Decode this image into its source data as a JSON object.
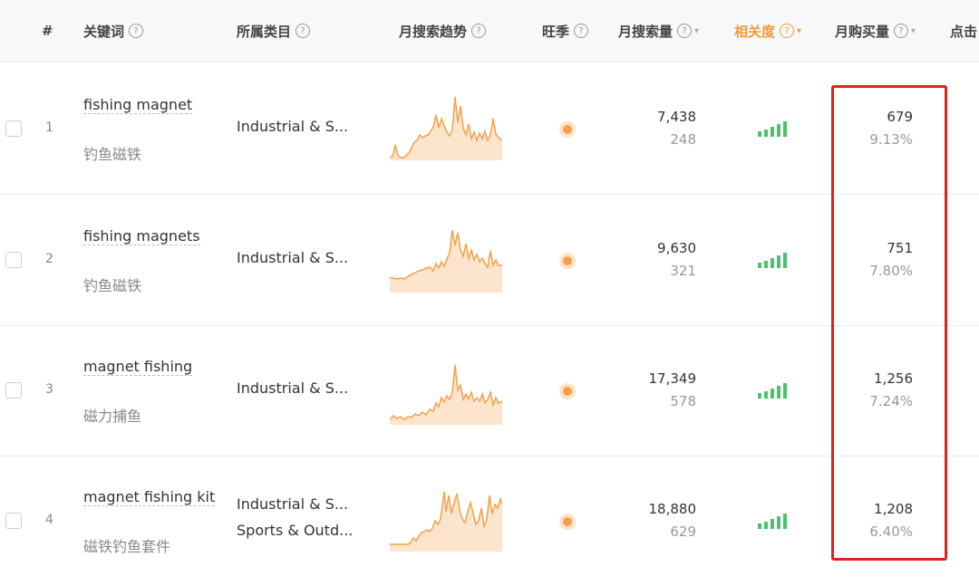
{
  "header": {
    "index": "#",
    "keyword": "关键词",
    "category": "所属类目",
    "trend": "月搜索趋势",
    "peak_season": "旺季",
    "monthly_search": "月搜索量",
    "relevance": "相关度",
    "monthly_purchase": "月购买量",
    "clicks": "点击"
  },
  "accent_color": "#f29a35",
  "highlight_color": "#e3211c",
  "rows": [
    {
      "index": "1",
      "keyword": "fishing magnet",
      "keyword_cn": "钓鱼磁铁",
      "categories": [
        "Industrial & S..."
      ],
      "search_volume": "7,438",
      "search_sub": "248",
      "relevance_level": 5,
      "purchase": "679",
      "purchase_rate": "9.13%"
    },
    {
      "index": "2",
      "keyword": "fishing magnets",
      "keyword_cn": "钓鱼磁铁",
      "categories": [
        "Industrial & S..."
      ],
      "search_volume": "9,630",
      "search_sub": "321",
      "relevance_level": 5,
      "purchase": "751",
      "purchase_rate": "7.80%"
    },
    {
      "index": "3",
      "keyword": "magnet fishing",
      "keyword_cn": "磁力捕鱼",
      "categories": [
        "Industrial & S..."
      ],
      "search_volume": "17,349",
      "search_sub": "578",
      "relevance_level": 5,
      "purchase": "1,256",
      "purchase_rate": "7.24%"
    },
    {
      "index": "4",
      "keyword": "magnet fishing kit",
      "keyword_cn": "磁铁钓鱼套件",
      "categories": [
        "Industrial & S...",
        "Sports & Outd..."
      ],
      "search_volume": "18,880",
      "search_sub": "629",
      "relevance_level": 5,
      "purchase": "1,208",
      "purchase_rate": "6.40%"
    }
  ]
}
